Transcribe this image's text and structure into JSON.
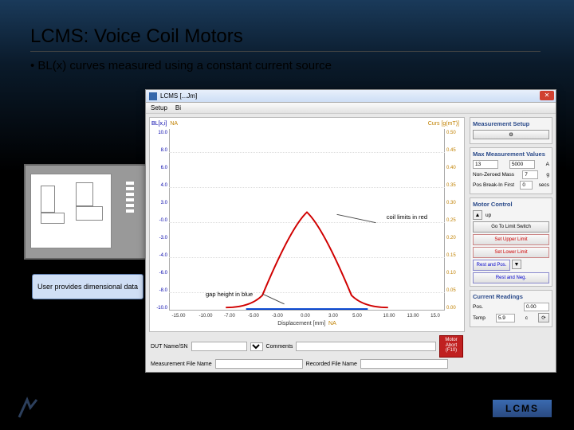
{
  "slide": {
    "title": "LCMS: Voice Coil Motors",
    "bullet": "BL(x) curves measured using a constant current source",
    "caption": "User provides dimensional data",
    "brand": "LCMS"
  },
  "window": {
    "title": "LCMS [...Jm]",
    "close": "✕",
    "menu_setup": "Setup",
    "menu_bi": "Bi"
  },
  "chart": {
    "y_label": "BL[x,i]",
    "y_na": "NA",
    "cursor": "Curs [g(mT)]",
    "x_label": "Displacement [mm]",
    "x_na": "NA",
    "annot_coil": "coil limits in red",
    "annot_gap": "gap height in blue"
  },
  "chart_data": {
    "type": "line",
    "xlabel": "Displacement [mm]",
    "ylabel_left": "BL[x,i]",
    "ylabel_right": "Curs [g(mT)]",
    "x_ticks": [
      "-15.00",
      "-10.00",
      "-7.00",
      "-5.00",
      "-3.00",
      "0.00",
      "3.00",
      "5.00",
      "10.00",
      "13.00",
      "15.0"
    ],
    "y_ticks_left": [
      "-10.0",
      "-8.0",
      "-6.0",
      "-4.0",
      "-3.0",
      "-0.0",
      "3.0",
      "4.0",
      "6.0",
      "8.0",
      "10.0"
    ],
    "y_ticks_right": [
      "0.00",
      "0.05",
      "0.10",
      "0.15",
      "0.20",
      "0.25",
      "0.30",
      "0.35",
      "0.40",
      "0.45",
      "0.50"
    ],
    "series": [
      {
        "name": "coil-limits",
        "color": "#d00000",
        "type": "bell",
        "x": [
          -8,
          -6,
          -4,
          -2,
          0,
          2,
          4,
          6,
          8
        ],
        "y": [
          0.02,
          0.06,
          0.16,
          0.25,
          0.28,
          0.25,
          0.16,
          0.06,
          0.02
        ]
      },
      {
        "name": "gap-height",
        "color": "#0040d0",
        "type": "flat",
        "x": [
          -7,
          7
        ],
        "y": [
          0.01,
          0.01
        ]
      }
    ]
  },
  "side": {
    "setup_title": "Measurement Setup",
    "setup_btn": "⚙",
    "max_title": "Max Measurement Values",
    "max_bl_val": "13",
    "max_current_val": "5000",
    "max_current_unit": "A",
    "nonzero_label": "Non-Zeroed Mass",
    "nonzero_val": "7",
    "nonzero_unit": "g",
    "break_label": "Pos Break-In First",
    "break_val": "0",
    "break_unit": "secs",
    "motor_title": "Motor Control",
    "up": "up",
    "btn_goto": "Go To Limit Switch",
    "btn_upper": "Set Upper Limit",
    "btn_lower": "Set Lower Limit",
    "btn_restpos": "Rest and Pos.",
    "btn_restneg": "Rest and Neg.",
    "readings_title": "Current Readings",
    "pos_label": "Pos.",
    "pos_val": "0.00",
    "temp_label": "Temp",
    "temp_val": "5.9",
    "temp_unit": "c",
    "temp_btn": "⟳"
  },
  "bottom": {
    "dut_label": "DUT Name/SN",
    "comments_label": "Comments",
    "meas_label": "Measurement File Name",
    "rec_label": "Recorded File Name",
    "abort1": "Motor",
    "abort2": "Abort",
    "abort3": "(F10)"
  }
}
